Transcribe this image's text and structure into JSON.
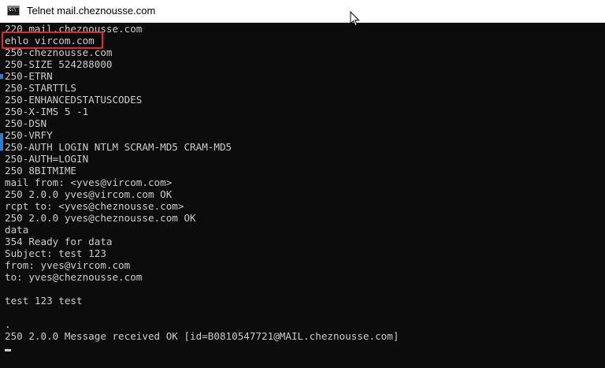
{
  "window": {
    "title": "Telnet mail.cheznousse.com",
    "icon": "command-prompt-icon",
    "icon_glyph": "C:\\"
  },
  "terminal": {
    "lines": [
      "220 mail.cheznousse.com",
      "ehlo vircom.com",
      "250-cheznousse.com",
      "250-SIZE 524288000",
      "250-ETRN",
      "250-STARTTLS",
      "250-ENHANCEDSTATUSCODES",
      "250-X-IMS 5 -1",
      "250-DSN",
      "250-VRFY",
      "250-AUTH LOGIN NTLM SCRAM-MD5 CRAM-MD5",
      "250-AUTH=LOGIN",
      "250 8BITMIME",
      "mail from: <yves@vircom.com>",
      "250 2.0.0 yves@vircom.com OK",
      "rcpt to: <yves@cheznousse.com>",
      "250 2.0.0 yves@cheznousse.com OK",
      "data",
      "354 Ready for data",
      "Subject: test 123",
      "from: yves@vircom.com",
      "to: yves@cheznousse.com",
      "",
      "test 123 test",
      "",
      ".",
      "250 2.0.0 Message received OK [id=B0810547721@MAIL.cheznousse.com]"
    ],
    "highlighted_command": "ehlo vircom.com",
    "highlight_color": "#e02b2b",
    "text_color": "#cccccc",
    "background_color": "#0c0c0c"
  }
}
